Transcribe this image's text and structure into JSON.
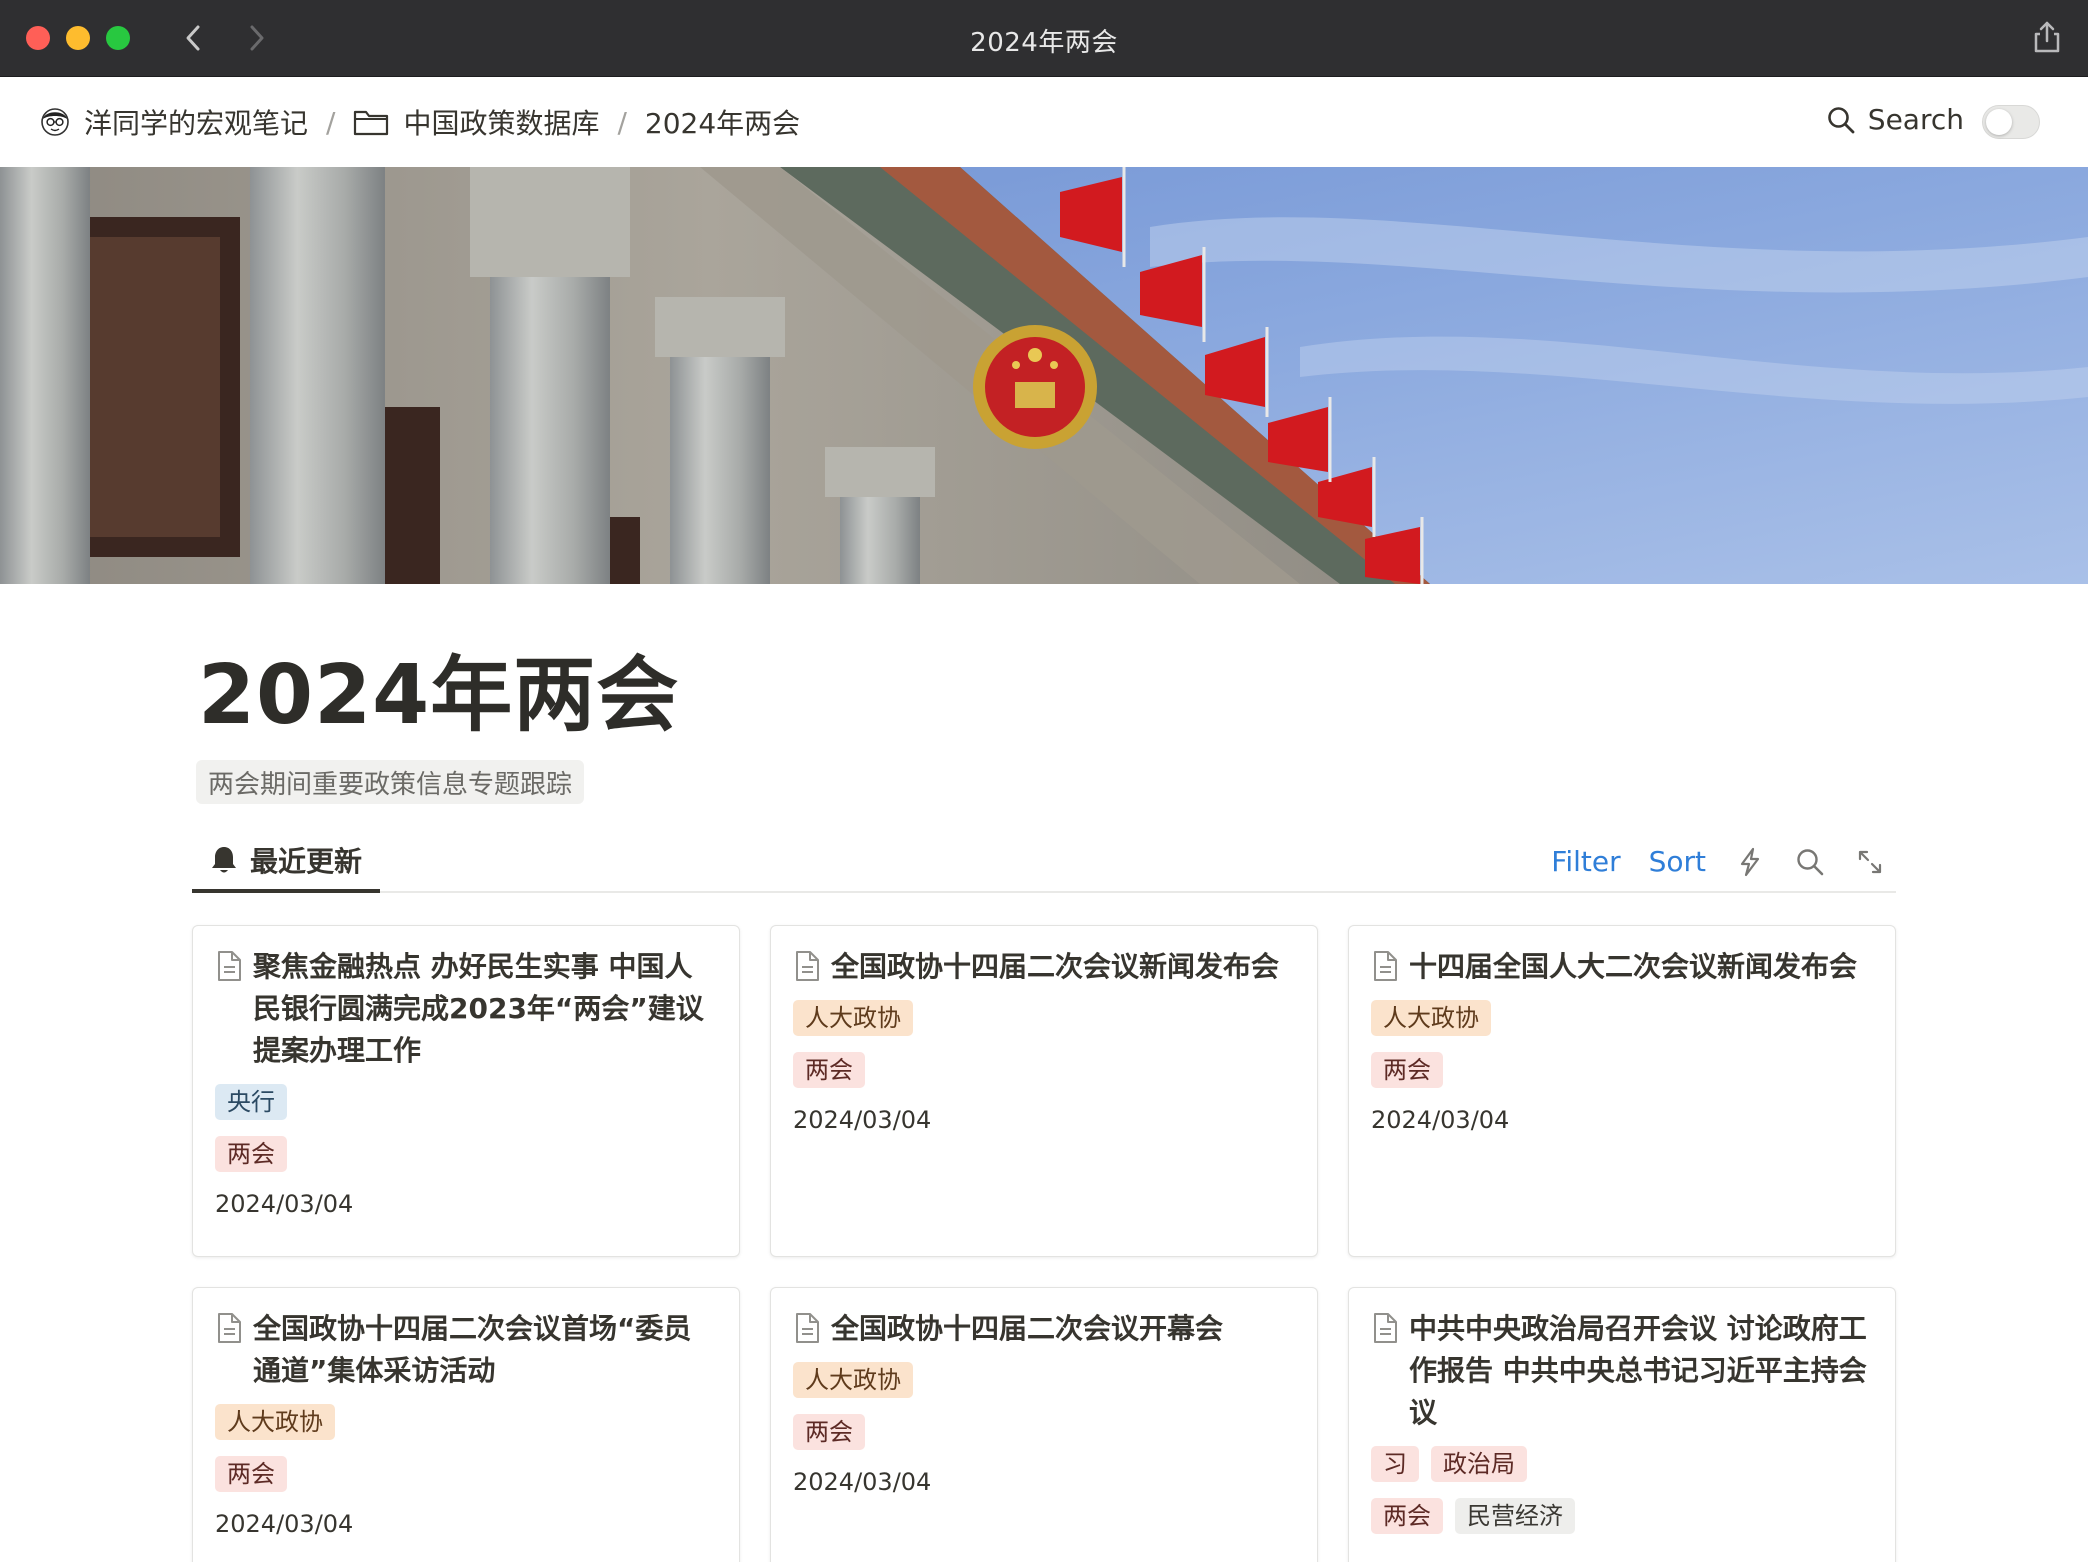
{
  "window": {
    "title": "2024年两会"
  },
  "breadcrumb": {
    "items": [
      "洋同学的宏观笔记",
      "中国政策数据库",
      "2024年两会"
    ],
    "separator": "/"
  },
  "topbar": {
    "search_label": "Search"
  },
  "page": {
    "title": "2024年两会",
    "description": "两会期间重要政策信息专题跟踪"
  },
  "view": {
    "tab_label": "最近更新",
    "filter_label": "Filter",
    "sort_label": "Sort"
  },
  "colors": {
    "accent_link": "#2f7ed8",
    "tag_blue": "#dce9f3",
    "tag_red": "#fbe2df",
    "tag_orange": "#fbe3cc",
    "tag_gray": "#eeeeec"
  },
  "cards": [
    {
      "title": "聚焦金融热点 办好民生实事 中国人民银行圆满完成2023年“两会”建议提案办理工作",
      "tag_rows": [
        [
          "央行"
        ],
        [
          "两会"
        ]
      ],
      "date": "2024/03/04"
    },
    {
      "title": "全国政协十四届二次会议新闻发布会",
      "tag_rows": [
        [
          "人大政协"
        ],
        [
          "两会"
        ]
      ],
      "date": "2024/03/04"
    },
    {
      "title": "十四届全国人大二次会议新闻发布会",
      "tag_rows": [
        [
          "人大政协"
        ],
        [
          "两会"
        ]
      ],
      "date": "2024/03/04"
    },
    {
      "title": "全国政协十四届二次会议首场“委员通道”集体采访活动",
      "tag_rows": [
        [
          "人大政协"
        ],
        [
          "两会"
        ]
      ],
      "date": "2024/03/04"
    },
    {
      "title": "全国政协十四届二次会议开幕会",
      "tag_rows": [
        [
          "人大政协"
        ],
        [
          "两会"
        ]
      ],
      "date": "2024/03/04"
    },
    {
      "title": "中共中央政治局召开会议 讨论政府工作报告 中共中央总书记习近平主持会议",
      "tag_rows": [
        [
          "习",
          "政治局"
        ],
        [
          "两会",
          "民营经济"
        ]
      ],
      "date": ""
    }
  ]
}
